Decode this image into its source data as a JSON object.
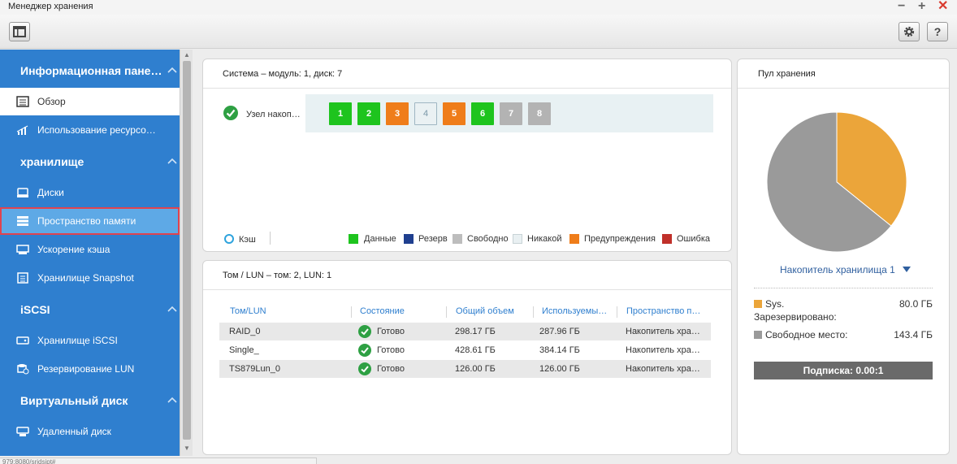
{
  "window": {
    "title": "Менеджер хранения",
    "minimize": "−",
    "maximize": "+",
    "close": "✕"
  },
  "toolbar": {
    "help": "?"
  },
  "sidebar": {
    "sections": [
      {
        "label": "Информационная пане…"
      },
      {
        "label": "хранилище"
      },
      {
        "label": "iSCSI"
      },
      {
        "label": "Виртуальный диск"
      }
    ],
    "items": [
      {
        "label": "Обзор",
        "icon": "overview-icon"
      },
      {
        "label": "Использование ресурсо…",
        "icon": "resource-chart-icon"
      },
      {
        "label": "Диски",
        "icon": "disk-icon"
      },
      {
        "label": "Пространство памяти",
        "icon": "storage-space-icon"
      },
      {
        "label": "Ускорение кэша",
        "icon": "cache-icon"
      },
      {
        "label": "Хранилище Snapshot",
        "icon": "snapshot-icon"
      },
      {
        "label": "Хранилище iSCSI",
        "icon": "iscsi-icon"
      },
      {
        "label": "Резервирование LUN",
        "icon": "lun-backup-icon"
      },
      {
        "label": "Удаленный диск",
        "icon": "remote-disk-icon"
      }
    ]
  },
  "system_panel": {
    "title": "Система – модуль: 1, диск: 7",
    "node_label": "Узел накоп…",
    "disks": [
      {
        "label": "1",
        "color": "#1ec41e"
      },
      {
        "label": "2",
        "color": "#1ec41e"
      },
      {
        "label": "3",
        "color": "#ef7d1a"
      },
      {
        "label": "4",
        "color": "#eaf1f3"
      },
      {
        "label": "5",
        "color": "#ef7d1a"
      },
      {
        "label": "6",
        "color": "#1ec41e"
      },
      {
        "label": "7",
        "color": "#b3b3b3"
      },
      {
        "label": "8",
        "color": "#b3b3b3"
      }
    ],
    "cache_label": "Кэш",
    "legend": [
      {
        "label": "Данные",
        "color": "#1ec41e"
      },
      {
        "label": "Резерв",
        "color": "#1f3f8f"
      },
      {
        "label": "Свободно",
        "color": "#bdbdbd"
      },
      {
        "label": "Никакой",
        "color": "#e9f0f2"
      },
      {
        "label": "Предупреждения",
        "color": "#ef7d1a"
      },
      {
        "label": "Ошибка",
        "color": "#c0302a"
      }
    ]
  },
  "volume_panel": {
    "title": "Том / LUN – том: 2, LUN: 1",
    "columns": [
      "Том/LUN",
      "Состояние",
      "Общий объем",
      "Используемы…",
      "Пространство п…"
    ],
    "rows": [
      {
        "name": "RAID_0",
        "status": "Готово",
        "total": "298.17 ГБ",
        "used": "287.96 ГБ",
        "pool": "Накопитель хра…"
      },
      {
        "name": "Single_",
        "status": "Готово",
        "total": "428.61 ГБ",
        "used": "384.14 ГБ",
        "pool": "Накопитель хра…"
      },
      {
        "name": "TS879Lun_0",
        "status": "Готово",
        "total": "126.00 ГБ",
        "used": "126.00 ГБ",
        "pool": "Накопитель хра…"
      }
    ]
  },
  "pool_panel": {
    "title": "Пул хранения",
    "pool_name": "Накопитель хранилища 1",
    "reserved_label_1": "Sys.",
    "reserved_label_2": "Зарезервировано:",
    "reserved_value": "80.0 ГБ",
    "free_label": "Свободное место:",
    "free_value": "143.4 ГБ",
    "subscription": "Подписка: 0.00:1"
  },
  "chart_data": {
    "type": "pie",
    "labels": [
      "Sys. Зарезервировано",
      "Свободное место"
    ],
    "values": [
      80.0,
      143.4
    ],
    "colors": [
      "#eba53a",
      "#9a9a9a"
    ]
  },
  "statusbar": {
    "text": "979:8080/sridsjpt#"
  }
}
